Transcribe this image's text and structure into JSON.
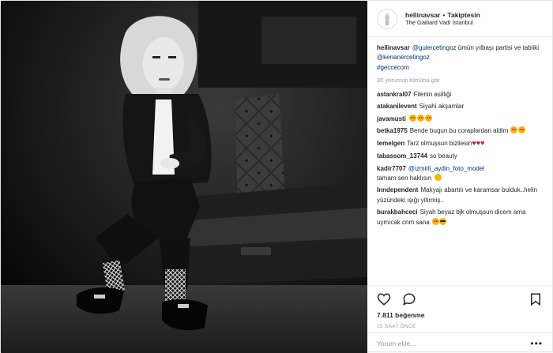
{
  "post": {
    "username": "hellinavsar",
    "separator": "•",
    "follow_status": "Takiptesin",
    "location": "The Galliard Vadi İstanbul",
    "caption": {
      "username": "hellinavsar",
      "mention1": "@gulercetingoz",
      "text1": " ümün yılbaşı partisi ve tabiiki ",
      "mention2": "@kenanercetingoz",
      "hashtag": "#geccecom"
    },
    "view_all_comments": "30 yorumun tümünü gör",
    "comments": [
      {
        "user": "aslankral07",
        "text": "Filenin asilliği"
      },
      {
        "user": "atakanilevent",
        "text": "Siyahi akşamlar"
      },
      {
        "user": "javamusti",
        "text": ""
      },
      {
        "user": "betka1975",
        "text": "Bende bugun bu coraplardan aldim"
      },
      {
        "user": "temelgen",
        "text": "Tarz olmuşsun bizilesin"
      },
      {
        "user": "tabassom_13744",
        "text": "so beauty"
      },
      {
        "user": "kadir7707",
        "mention": "@izmirli_aydin_foto_model",
        "text": "tamam sen haklısın"
      },
      {
        "user": "Inndependent",
        "text": "Makyajı abartılı ve karamsar bulduk..helin yüzündeki ışığı yitirmiş.."
      },
      {
        "user": "burakbahceci",
        "text": "Siyah beyaz bjk olmuşsun dicem ama uymıcak cnm sana"
      }
    ],
    "likes": "7.811 beğenme",
    "timestamp": "15 SAAT ÖNCE",
    "add_comment_placeholder": "Yorum ekle...",
    "more_options": "•••"
  },
  "icons": {
    "like": "heart-outline-icon",
    "comment": "comment-bubble-icon",
    "bookmark": "bookmark-icon"
  },
  "colors": {
    "mention": "#003569",
    "muted": "#999999",
    "text": "#262626"
  }
}
